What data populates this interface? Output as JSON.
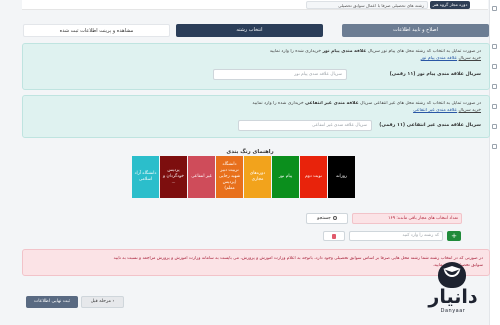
{
  "topbar": {
    "field_text": "رشته های تحصیلی صرفا با اعمال سوابق تحصیلی",
    "chip_text": "دوره مجاز گروه هنر"
  },
  "steps": [
    {
      "label": "اصلاح و تایید اطلاعات"
    },
    {
      "label": "انتخاب رشته"
    },
    {
      "label": "مشاهده و پرینت اطلاعات ثبت شده"
    }
  ],
  "panel1": {
    "line1_pre": "در صورت تمایل به انتخاب کد رشته محل های پیام نور سریال",
    "line1_bold": "علاقه مندی پیام نور",
    "line1_post": "خریداری شده را وارد نمایید",
    "line2_pre": "خرید سریال",
    "line2_link": "علاقه مندی پیام نور",
    "label": "سریال علاقه مندی پیام نور (۱۱ رقمی)",
    "placeholder": "سریال علاقه مندی پیام نور"
  },
  "panel2": {
    "line1_pre": "در صورت تمایل به انتخاب کد رشته محل های غیر انتفاعی سریال",
    "line1_bold": "علاقه مندی غیر انتفاعی",
    "line1_post": "خریداری شده را وارد نمایید",
    "line2_pre": "خرید سریال",
    "line2_link": "علاقه مندی غیر انتفاعی",
    "label": "سریال علاقه مندی غیر انتفاعی (۱۱ رقمی)",
    "placeholder": "سریال علاقه مندی غیر انتفاعی"
  },
  "guide_title": "راهنمای رنگ بندی",
  "swatches": [
    {
      "label": "روزانه",
      "color": "#000000",
      "text_color": "#ffffff"
    },
    {
      "label": "نوبت دوم",
      "color": "#e8230b",
      "text_color": "#ffffff"
    },
    {
      "label": "پیام نور",
      "color": "#0b8f1d",
      "text_color": "#ffffff"
    },
    {
      "label": "دوره‌های مجازی",
      "color": "#f2a31c",
      "text_color": "#ffffff"
    },
    {
      "label": "دانشگاه تربیت دبیر شهید رجایی (پردیس معلم)",
      "color": "#e8701c",
      "text_color": "#ffffff"
    },
    {
      "label": "غیر انتفاعی",
      "color": "#cf4c5a",
      "text_color": "#ffffff"
    },
    {
      "label": "پردیس خودگردان و ...",
      "color": "#7d0e0e",
      "text_color": "#ffffff"
    },
    {
      "label": "دانشگاه آزاد اسلامی",
      "color": "#2bbecb",
      "text_color": "#ffffff"
    }
  ],
  "search": {
    "button_label": "جستجو",
    "notice": "تعداد انتخاب های مجاز باقی مانده: ۱۶۹"
  },
  "code_row": {
    "placeholder": "کد رشته را وارد کنید",
    "add_symbol": "+"
  },
  "warning": {
    "line1": "در صورتی که در انتخاب رشته شما رشته محل هایی صرفا بر اساس سوابق تحصیلی وجود دارد، باتوجه به اعلام وزارت آموزش و پرورش، می بایست به سامانه وزارت آموزش و پرورش مراجعه و نسبت به تایید",
    "line2": "سوابق تحصیلی اقدام نمایید."
  },
  "buttons": {
    "prev": "مرحله قبل",
    "final": "ثبت نهایی اطلاعات"
  },
  "logo": {
    "text": "دانیار",
    "sub": "Danyaar"
  }
}
